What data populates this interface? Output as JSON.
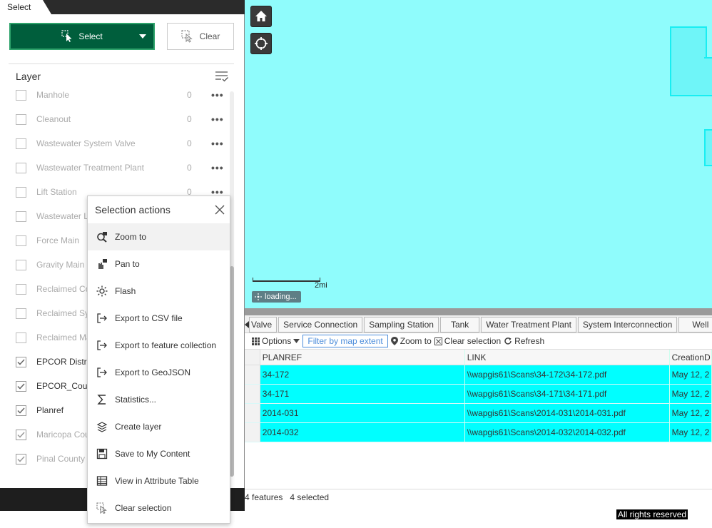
{
  "panel": {
    "tab_label": "Select",
    "select_button": "Select",
    "clear_button": "Clear",
    "layer_heading": "Layer",
    "layers": [
      {
        "name": "Manhole",
        "count": "0",
        "checked": false
      },
      {
        "name": "Cleanout",
        "count": "0",
        "checked": false
      },
      {
        "name": "Wastewater System Valve",
        "count": "0",
        "checked": false
      },
      {
        "name": "Wastewater Treatment Plant",
        "count": "0",
        "checked": false
      },
      {
        "name": "Lift Station",
        "count": "0",
        "checked": false
      },
      {
        "name": "Wastewater L",
        "count": "",
        "checked": false
      },
      {
        "name": "Force Main",
        "count": "",
        "checked": false
      },
      {
        "name": "Gravity Main",
        "count": "",
        "checked": false
      },
      {
        "name": "Reclaimed Co",
        "count": "",
        "checked": false
      },
      {
        "name": "Reclaimed Sy",
        "count": "",
        "checked": false
      },
      {
        "name": "Reclaimed Ma",
        "count": "",
        "checked": false
      },
      {
        "name": "EPCOR Distric",
        "count": "",
        "checked": true
      },
      {
        "name": "EPCOR_Coun",
        "count": "",
        "checked": true
      },
      {
        "name": "Planref",
        "count": "",
        "checked": true
      },
      {
        "name": "Maricopa Cou",
        "count": "",
        "checked": true
      },
      {
        "name": "Pinal County",
        "count": "",
        "checked": true
      }
    ]
  },
  "popup": {
    "title": "Selection actions",
    "items": [
      {
        "label": "Zoom to",
        "icon": "zoom-icon"
      },
      {
        "label": "Pan to",
        "icon": "pan-icon"
      },
      {
        "label": "Flash",
        "icon": "flash-icon"
      },
      {
        "label": "Export to CSV file",
        "icon": "export-icon"
      },
      {
        "label": "Export to feature collection",
        "icon": "export-icon"
      },
      {
        "label": "Export to GeoJSON",
        "icon": "export-icon"
      },
      {
        "label": "Statistics...",
        "icon": "sigma-icon"
      },
      {
        "label": "Create layer",
        "icon": "layer-icon"
      },
      {
        "label": "Save to My Content",
        "icon": "save-icon"
      },
      {
        "label": "View in Attribute Table",
        "icon": "table-icon"
      },
      {
        "label": "Clear selection",
        "icon": "clear-icon"
      }
    ]
  },
  "map": {
    "scale_label": "2mi",
    "loading_label": "loading..."
  },
  "table": {
    "tabs": [
      "Valve",
      "Service Connection",
      "Sampling Station",
      "Tank",
      "Water Treatment Plant",
      "System Interconnection",
      "Well"
    ],
    "toolbar": {
      "options": "Options",
      "filter": "Filter by map extent",
      "zoom": "Zoom to",
      "clear": "Clear selection",
      "refresh": "Refresh"
    },
    "columns": [
      "PLANREF",
      "LINK",
      "CreationD"
    ],
    "rows": [
      [
        "34-172",
        "\\\\wapgis61\\Scans\\34-172\\34-172.pdf",
        "May 12, 2"
      ],
      [
        "34-171",
        "\\\\wapgis61\\Scans\\34-171\\34-171.pdf",
        "May 12, 2"
      ],
      [
        "2014-031",
        "\\\\wapgis61\\Scans\\2014-031\\2014-031.pdf",
        "May 12, 2"
      ],
      [
        "2014-032",
        "\\\\wapgis61\\Scans\\2014-032\\2014-032.pdf",
        "May 12, 2"
      ]
    ],
    "footer_features": "4 features",
    "footer_selected": "4 selected"
  },
  "footer": {
    "rights": "All rights reserved"
  },
  "colors": {
    "select_green": "#005e3c",
    "map_cyan": "#8ffcfc",
    "selected_row": "#00ffff"
  }
}
